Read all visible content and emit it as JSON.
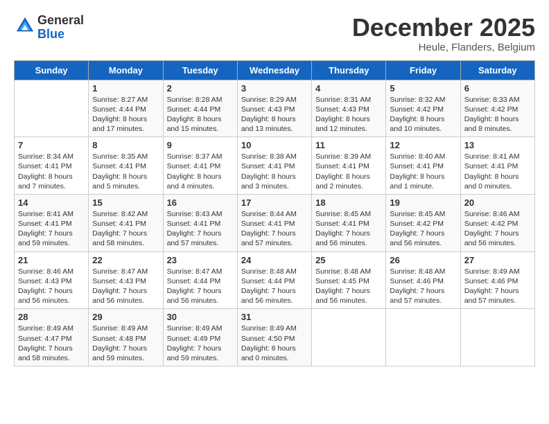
{
  "header": {
    "logo_line1": "General",
    "logo_line2": "Blue",
    "month": "December 2025",
    "location": "Heule, Flanders, Belgium"
  },
  "weekdays": [
    "Sunday",
    "Monday",
    "Tuesday",
    "Wednesday",
    "Thursday",
    "Friday",
    "Saturday"
  ],
  "weeks": [
    [
      {
        "day": "",
        "info": ""
      },
      {
        "day": "1",
        "info": "Sunrise: 8:27 AM\nSunset: 4:44 PM\nDaylight: 8 hours\nand 17 minutes."
      },
      {
        "day": "2",
        "info": "Sunrise: 8:28 AM\nSunset: 4:44 PM\nDaylight: 8 hours\nand 15 minutes."
      },
      {
        "day": "3",
        "info": "Sunrise: 8:29 AM\nSunset: 4:43 PM\nDaylight: 8 hours\nand 13 minutes."
      },
      {
        "day": "4",
        "info": "Sunrise: 8:31 AM\nSunset: 4:43 PM\nDaylight: 8 hours\nand 12 minutes."
      },
      {
        "day": "5",
        "info": "Sunrise: 8:32 AM\nSunset: 4:42 PM\nDaylight: 8 hours\nand 10 minutes."
      },
      {
        "day": "6",
        "info": "Sunrise: 8:33 AM\nSunset: 4:42 PM\nDaylight: 8 hours\nand 8 minutes."
      }
    ],
    [
      {
        "day": "7",
        "info": "Sunrise: 8:34 AM\nSunset: 4:41 PM\nDaylight: 8 hours\nand 7 minutes."
      },
      {
        "day": "8",
        "info": "Sunrise: 8:35 AM\nSunset: 4:41 PM\nDaylight: 8 hours\nand 5 minutes."
      },
      {
        "day": "9",
        "info": "Sunrise: 8:37 AM\nSunset: 4:41 PM\nDaylight: 8 hours\nand 4 minutes."
      },
      {
        "day": "10",
        "info": "Sunrise: 8:38 AM\nSunset: 4:41 PM\nDaylight: 8 hours\nand 3 minutes."
      },
      {
        "day": "11",
        "info": "Sunrise: 8:39 AM\nSunset: 4:41 PM\nDaylight: 8 hours\nand 2 minutes."
      },
      {
        "day": "12",
        "info": "Sunrise: 8:40 AM\nSunset: 4:41 PM\nDaylight: 8 hours\nand 1 minute."
      },
      {
        "day": "13",
        "info": "Sunrise: 8:41 AM\nSunset: 4:41 PM\nDaylight: 8 hours\nand 0 minutes."
      }
    ],
    [
      {
        "day": "14",
        "info": "Sunrise: 8:41 AM\nSunset: 4:41 PM\nDaylight: 7 hours\nand 59 minutes."
      },
      {
        "day": "15",
        "info": "Sunrise: 8:42 AM\nSunset: 4:41 PM\nDaylight: 7 hours\nand 58 minutes."
      },
      {
        "day": "16",
        "info": "Sunrise: 8:43 AM\nSunset: 4:41 PM\nDaylight: 7 hours\nand 57 minutes."
      },
      {
        "day": "17",
        "info": "Sunrise: 8:44 AM\nSunset: 4:41 PM\nDaylight: 7 hours\nand 57 minutes."
      },
      {
        "day": "18",
        "info": "Sunrise: 8:45 AM\nSunset: 4:41 PM\nDaylight: 7 hours\nand 56 minutes."
      },
      {
        "day": "19",
        "info": "Sunrise: 8:45 AM\nSunset: 4:42 PM\nDaylight: 7 hours\nand 56 minutes."
      },
      {
        "day": "20",
        "info": "Sunrise: 8:46 AM\nSunset: 4:42 PM\nDaylight: 7 hours\nand 56 minutes."
      }
    ],
    [
      {
        "day": "21",
        "info": "Sunrise: 8:46 AM\nSunset: 4:43 PM\nDaylight: 7 hours\nand 56 minutes."
      },
      {
        "day": "22",
        "info": "Sunrise: 8:47 AM\nSunset: 4:43 PM\nDaylight: 7 hours\nand 56 minutes."
      },
      {
        "day": "23",
        "info": "Sunrise: 8:47 AM\nSunset: 4:44 PM\nDaylight: 7 hours\nand 56 minutes."
      },
      {
        "day": "24",
        "info": "Sunrise: 8:48 AM\nSunset: 4:44 PM\nDaylight: 7 hours\nand 56 minutes."
      },
      {
        "day": "25",
        "info": "Sunrise: 8:48 AM\nSunset: 4:45 PM\nDaylight: 7 hours\nand 56 minutes."
      },
      {
        "day": "26",
        "info": "Sunrise: 8:48 AM\nSunset: 4:46 PM\nDaylight: 7 hours\nand 57 minutes."
      },
      {
        "day": "27",
        "info": "Sunrise: 8:49 AM\nSunset: 4:46 PM\nDaylight: 7 hours\nand 57 minutes."
      }
    ],
    [
      {
        "day": "28",
        "info": "Sunrise: 8:49 AM\nSunset: 4:47 PM\nDaylight: 7 hours\nand 58 minutes."
      },
      {
        "day": "29",
        "info": "Sunrise: 8:49 AM\nSunset: 4:48 PM\nDaylight: 7 hours\nand 59 minutes."
      },
      {
        "day": "30",
        "info": "Sunrise: 8:49 AM\nSunset: 4:49 PM\nDaylight: 7 hours\nand 59 minutes."
      },
      {
        "day": "31",
        "info": "Sunrise: 8:49 AM\nSunset: 4:50 PM\nDaylight: 8 hours\nand 0 minutes."
      },
      {
        "day": "",
        "info": ""
      },
      {
        "day": "",
        "info": ""
      },
      {
        "day": "",
        "info": ""
      }
    ]
  ]
}
